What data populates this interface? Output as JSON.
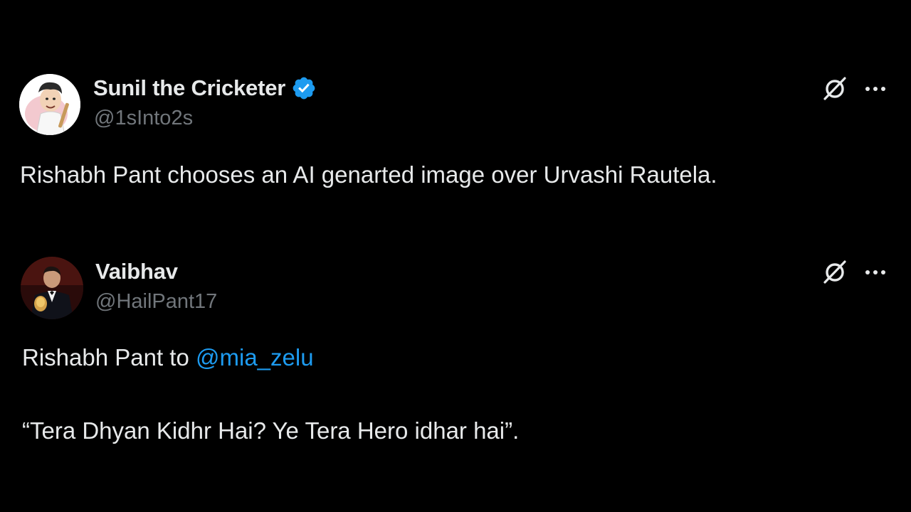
{
  "tweets": [
    {
      "display_name": "Sunil the Cricketer",
      "handle": "@1sInto2s",
      "verified": true,
      "text": "Rishabh Pant chooses an AI genarted image over Urvashi Rautela."
    },
    {
      "display_name": "Vaibhav",
      "handle": "@HailPant17",
      "verified": false,
      "text_prefix": "Rishabh Pant to ",
      "mention": "@mia_zelu",
      "text_line2": "“Tera Dhyan Kidhr Hai? Ye Tera Hero idhar hai”."
    }
  ],
  "colors": {
    "background": "#000000",
    "primary_text": "#e7e9ea",
    "secondary_text": "#71767b",
    "link": "#1d9bf0",
    "verified_badge": "#1d9bf0"
  },
  "icons": {
    "verified": "verified-badge-icon",
    "grok": "grok-icon",
    "more": "more-options-icon"
  }
}
